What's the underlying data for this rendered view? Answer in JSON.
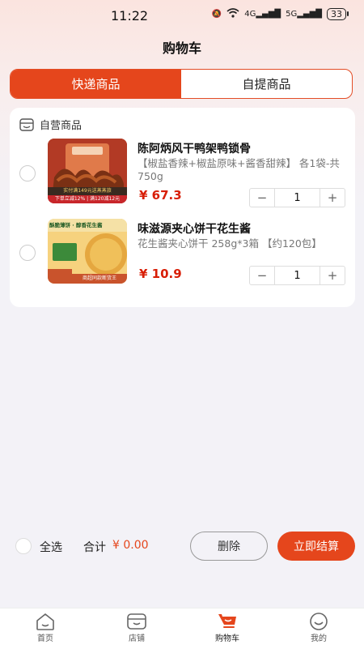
{
  "status": {
    "time": "11:22",
    "battery": "33",
    "net1": "4G",
    "net2": "5G"
  },
  "title": "购物车",
  "tabs": [
    {
      "label": "快递商品",
      "active": true
    },
    {
      "label": "自提商品",
      "active": false
    }
  ],
  "section": {
    "label": "自营商品"
  },
  "items": [
    {
      "name": "陈阿炳风干鸭架鸭锁骨",
      "desc": "【椒盐香辣+椒盐原味+酱香甜辣】 各1袋-共750g",
      "price": "¥ 67.3",
      "qty": "1",
      "minus": "−",
      "plus": "+",
      "thumb_text_1": "实付满149元送蒸蒸旅",
      "thumb_text_2": "下单立减12% | 满120减12元"
    },
    {
      "name": "味滋源夹心饼干花生酱",
      "desc": "花生酱夹心饼干 258g*3箱 【约120包】",
      "price": "¥ 10.9",
      "qty": "1",
      "minus": "−",
      "plus": "+",
      "thumb_text_1": "酥脆薄饼 · 醇香花生酱",
      "thumb_text_2": "商超同款断货王"
    }
  ],
  "footer": {
    "select_all": "全选",
    "total_label": "合计",
    "total_value": "¥ 0.00",
    "delete": "删除",
    "checkout": "立即结算"
  },
  "tabbar": [
    {
      "label": "首页",
      "icon": "home-icon"
    },
    {
      "label": "店铺",
      "icon": "shop-icon"
    },
    {
      "label": "购物车",
      "icon": "cart-icon"
    },
    {
      "label": "我的",
      "icon": "profile-icon"
    }
  ],
  "colors": {
    "accent": "#e5461c",
    "price": "#d81e06"
  }
}
